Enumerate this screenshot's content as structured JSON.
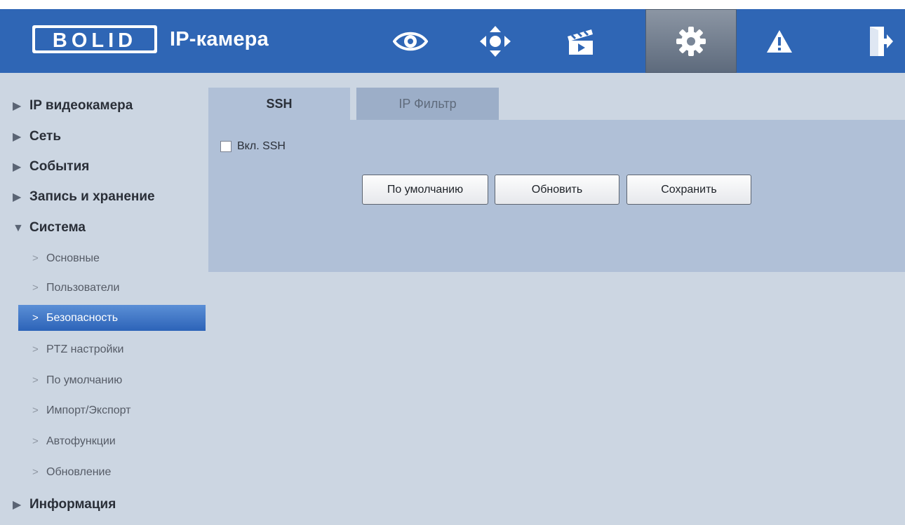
{
  "header": {
    "logo_text": "BOLID",
    "title": "IP-камера",
    "nav": [
      {
        "icon": "eye-icon"
      },
      {
        "icon": "ptz-icon"
      },
      {
        "icon": "clapperboard-icon"
      },
      {
        "icon": "gear-icon",
        "active": true
      },
      {
        "icon": "warning-icon"
      },
      {
        "icon": "logout-icon"
      }
    ]
  },
  "sidebar": {
    "categories": {
      "camera": "IP видеокамера",
      "network": "Сеть",
      "events": "События",
      "storage": "Запись и хранение",
      "system": "Система",
      "info": "Информация"
    },
    "system_items": [
      "Основные",
      "Пользователи",
      "Безопасность",
      "PTZ настройки",
      "По умолчанию",
      "Импорт/Экспорт",
      "Автофункции",
      "Обновление"
    ],
    "collapsed_mark": "▶",
    "expanded_mark": "▼",
    "sub_mark": ">"
  },
  "content": {
    "tabs": [
      "SSH",
      "IP Фильтр"
    ],
    "ssh_checkbox_label": "Вкл. SSH",
    "buttons": {
      "default": "По умолчанию",
      "refresh": "Обновить",
      "save": "Сохранить"
    }
  },
  "colors": {
    "header_bg": "#2f66b5",
    "page_bg": "#ccd6e2",
    "panel_bg": "#b0c0d7",
    "active_item": "#3a72c4"
  }
}
